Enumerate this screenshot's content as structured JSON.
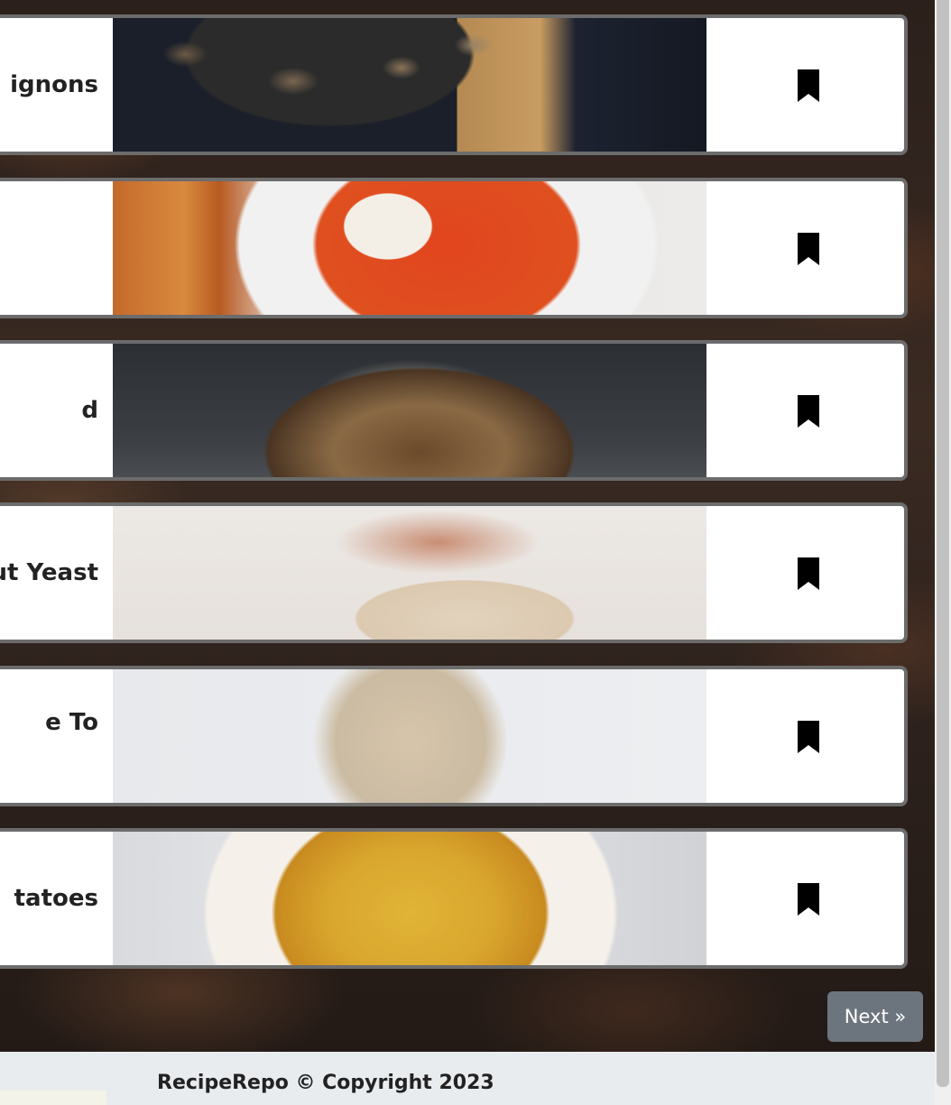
{
  "recipes": [
    {
      "title": "ignons",
      "image": "mushroom-skillet-image",
      "bookmark_icon": "bookmark-icon"
    },
    {
      "title": "",
      "image": "tomato-soup-image",
      "bookmark_icon": "bookmark-icon"
    },
    {
      "title": "d",
      "image": "sourdough-bread-image",
      "bookmark_icon": "bookmark-icon"
    },
    {
      "title": "ut Yeast",
      "image": "dough-kneading-image",
      "bookmark_icon": "bookmark-icon"
    },
    {
      "title": "e To",
      "image": "granola-bowl-image",
      "bookmark_icon": "bookmark-icon"
    },
    {
      "title": "tatoes",
      "image": "roasted-potatoes-image",
      "bookmark_icon": "bookmark-icon"
    }
  ],
  "pagination": {
    "next_label": "Next »"
  },
  "footer": {
    "text": "RecipeRepo © Copyright 2023"
  },
  "colors": {
    "card_border": "#6c6c6c",
    "next_button": "#6c757d",
    "footer_bg": "#e9ecef"
  }
}
